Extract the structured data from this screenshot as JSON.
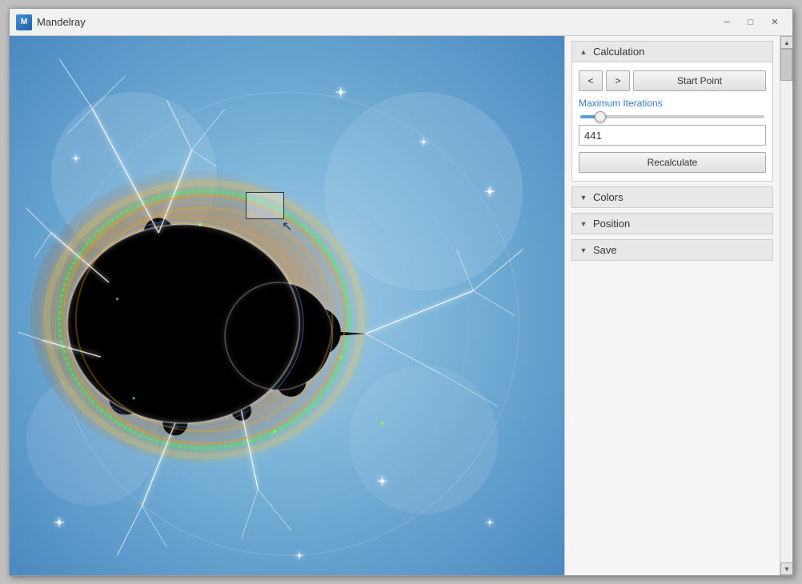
{
  "window": {
    "title": "Mandelray",
    "icon_label": "M"
  },
  "title_controls": {
    "minimize_label": "─",
    "maximize_label": "□",
    "close_label": "✕"
  },
  "right_panel": {
    "sections": [
      {
        "id": "calculation",
        "title": "Calculation",
        "expanded": true,
        "toggle_icon": "▲"
      },
      {
        "id": "colors",
        "title": "Colors",
        "expanded": false,
        "toggle_icon": "▼"
      },
      {
        "id": "position",
        "title": "Position",
        "expanded": false,
        "toggle_icon": "▼"
      },
      {
        "id": "save",
        "title": "Save",
        "expanded": false,
        "toggle_icon": "▼"
      }
    ],
    "calculation": {
      "prev_btn": "<",
      "next_btn": ">",
      "start_point_btn": "Start Point",
      "max_iterations_label": "Maximum Iterations",
      "iteration_value": "441",
      "recalculate_btn": "Recalculate",
      "slider_pct": 10
    }
  }
}
